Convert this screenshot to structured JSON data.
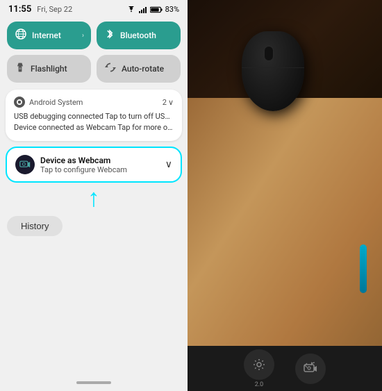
{
  "statusBar": {
    "time": "11:55",
    "date": "Fri, Sep 22",
    "battery": "83%",
    "batteryIcon": "🔋",
    "signalIcon": "📶"
  },
  "quickTiles": [
    {
      "id": "internet",
      "label": "Internet",
      "icon": "wifi",
      "active": true,
      "hasArrow": true
    },
    {
      "id": "bluetooth",
      "label": "Bluetooth",
      "icon": "bluetooth",
      "active": true,
      "hasArrow": false
    },
    {
      "id": "flashlight",
      "label": "Flashlight",
      "icon": "flashlight",
      "active": false,
      "hasArrow": false
    },
    {
      "id": "autorotate",
      "label": "Auto-rotate",
      "icon": "rotate",
      "active": false,
      "hasArrow": false
    }
  ],
  "androidSystemNotif": {
    "appName": "Android System",
    "count": "2",
    "lines": [
      "USB debugging connected Tap to turn off USB...",
      "Device connected as Webcam Tap for more op..."
    ]
  },
  "webcamNotif": {
    "title": "Device as Webcam",
    "subtitle": "Tap to configure Webcam",
    "highlighted": true
  },
  "historyButton": "History",
  "camera": {
    "zoomLevel": "2.0",
    "settingsLabel": "Settings",
    "switchLabel": "Switch"
  },
  "arrowIndicator": "↑"
}
